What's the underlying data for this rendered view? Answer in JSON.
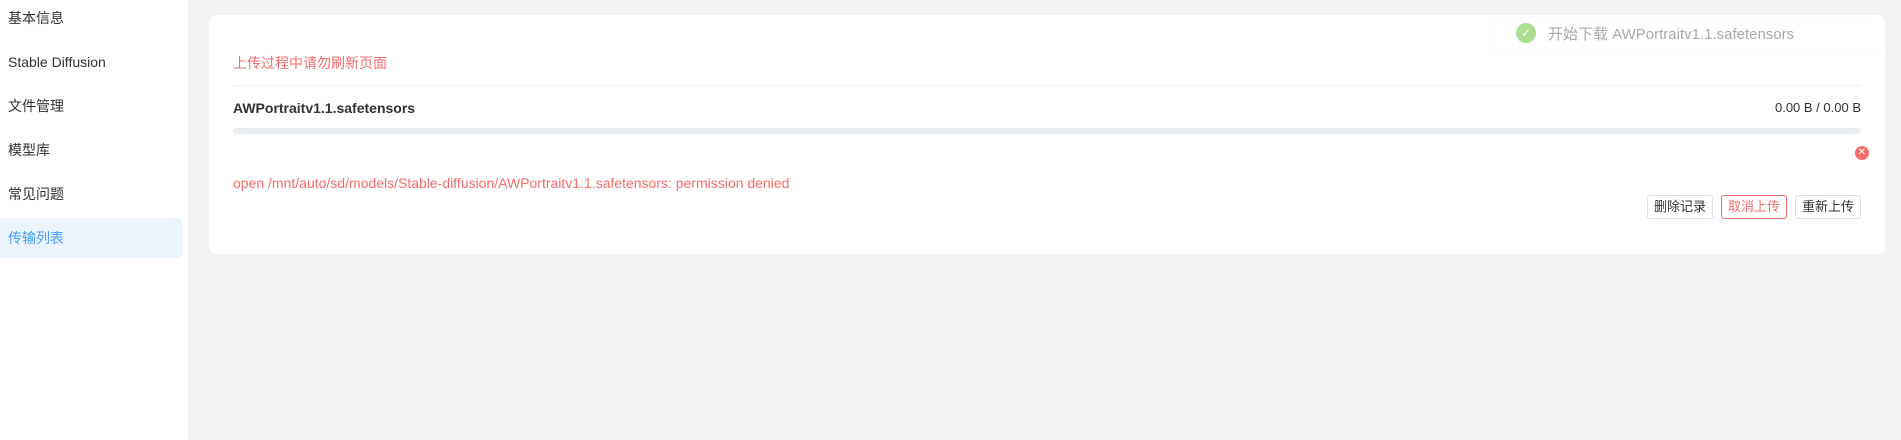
{
  "sidebar": {
    "items": [
      {
        "label": "基本信息"
      },
      {
        "label": "Stable Diffusion"
      },
      {
        "label": "文件管理"
      },
      {
        "label": "模型库"
      },
      {
        "label": "常见问题"
      },
      {
        "label": "传输列表",
        "active": true
      }
    ]
  },
  "transfer": {
    "notice": "上传过程中请勿刷新页面",
    "file_name": "AWPortraitv1.1.safetensors",
    "file_size": "0.00 B / 0.00 B",
    "progress": 0,
    "error_message": "open /mnt/auto/sd/models/Stable-diffusion/AWPortraitv1.1.safetensors: permission denied",
    "actions": {
      "delete_label": "删除记录",
      "cancel_label": "取消上传",
      "retry_label": "重新上传"
    }
  },
  "toast": {
    "message": "开始下载 AWPortraitv1.1.safetensors",
    "icon": "check-icon"
  },
  "colors": {
    "accent": "#409eff",
    "danger": "#f56c6c",
    "success": "#67c23a"
  }
}
